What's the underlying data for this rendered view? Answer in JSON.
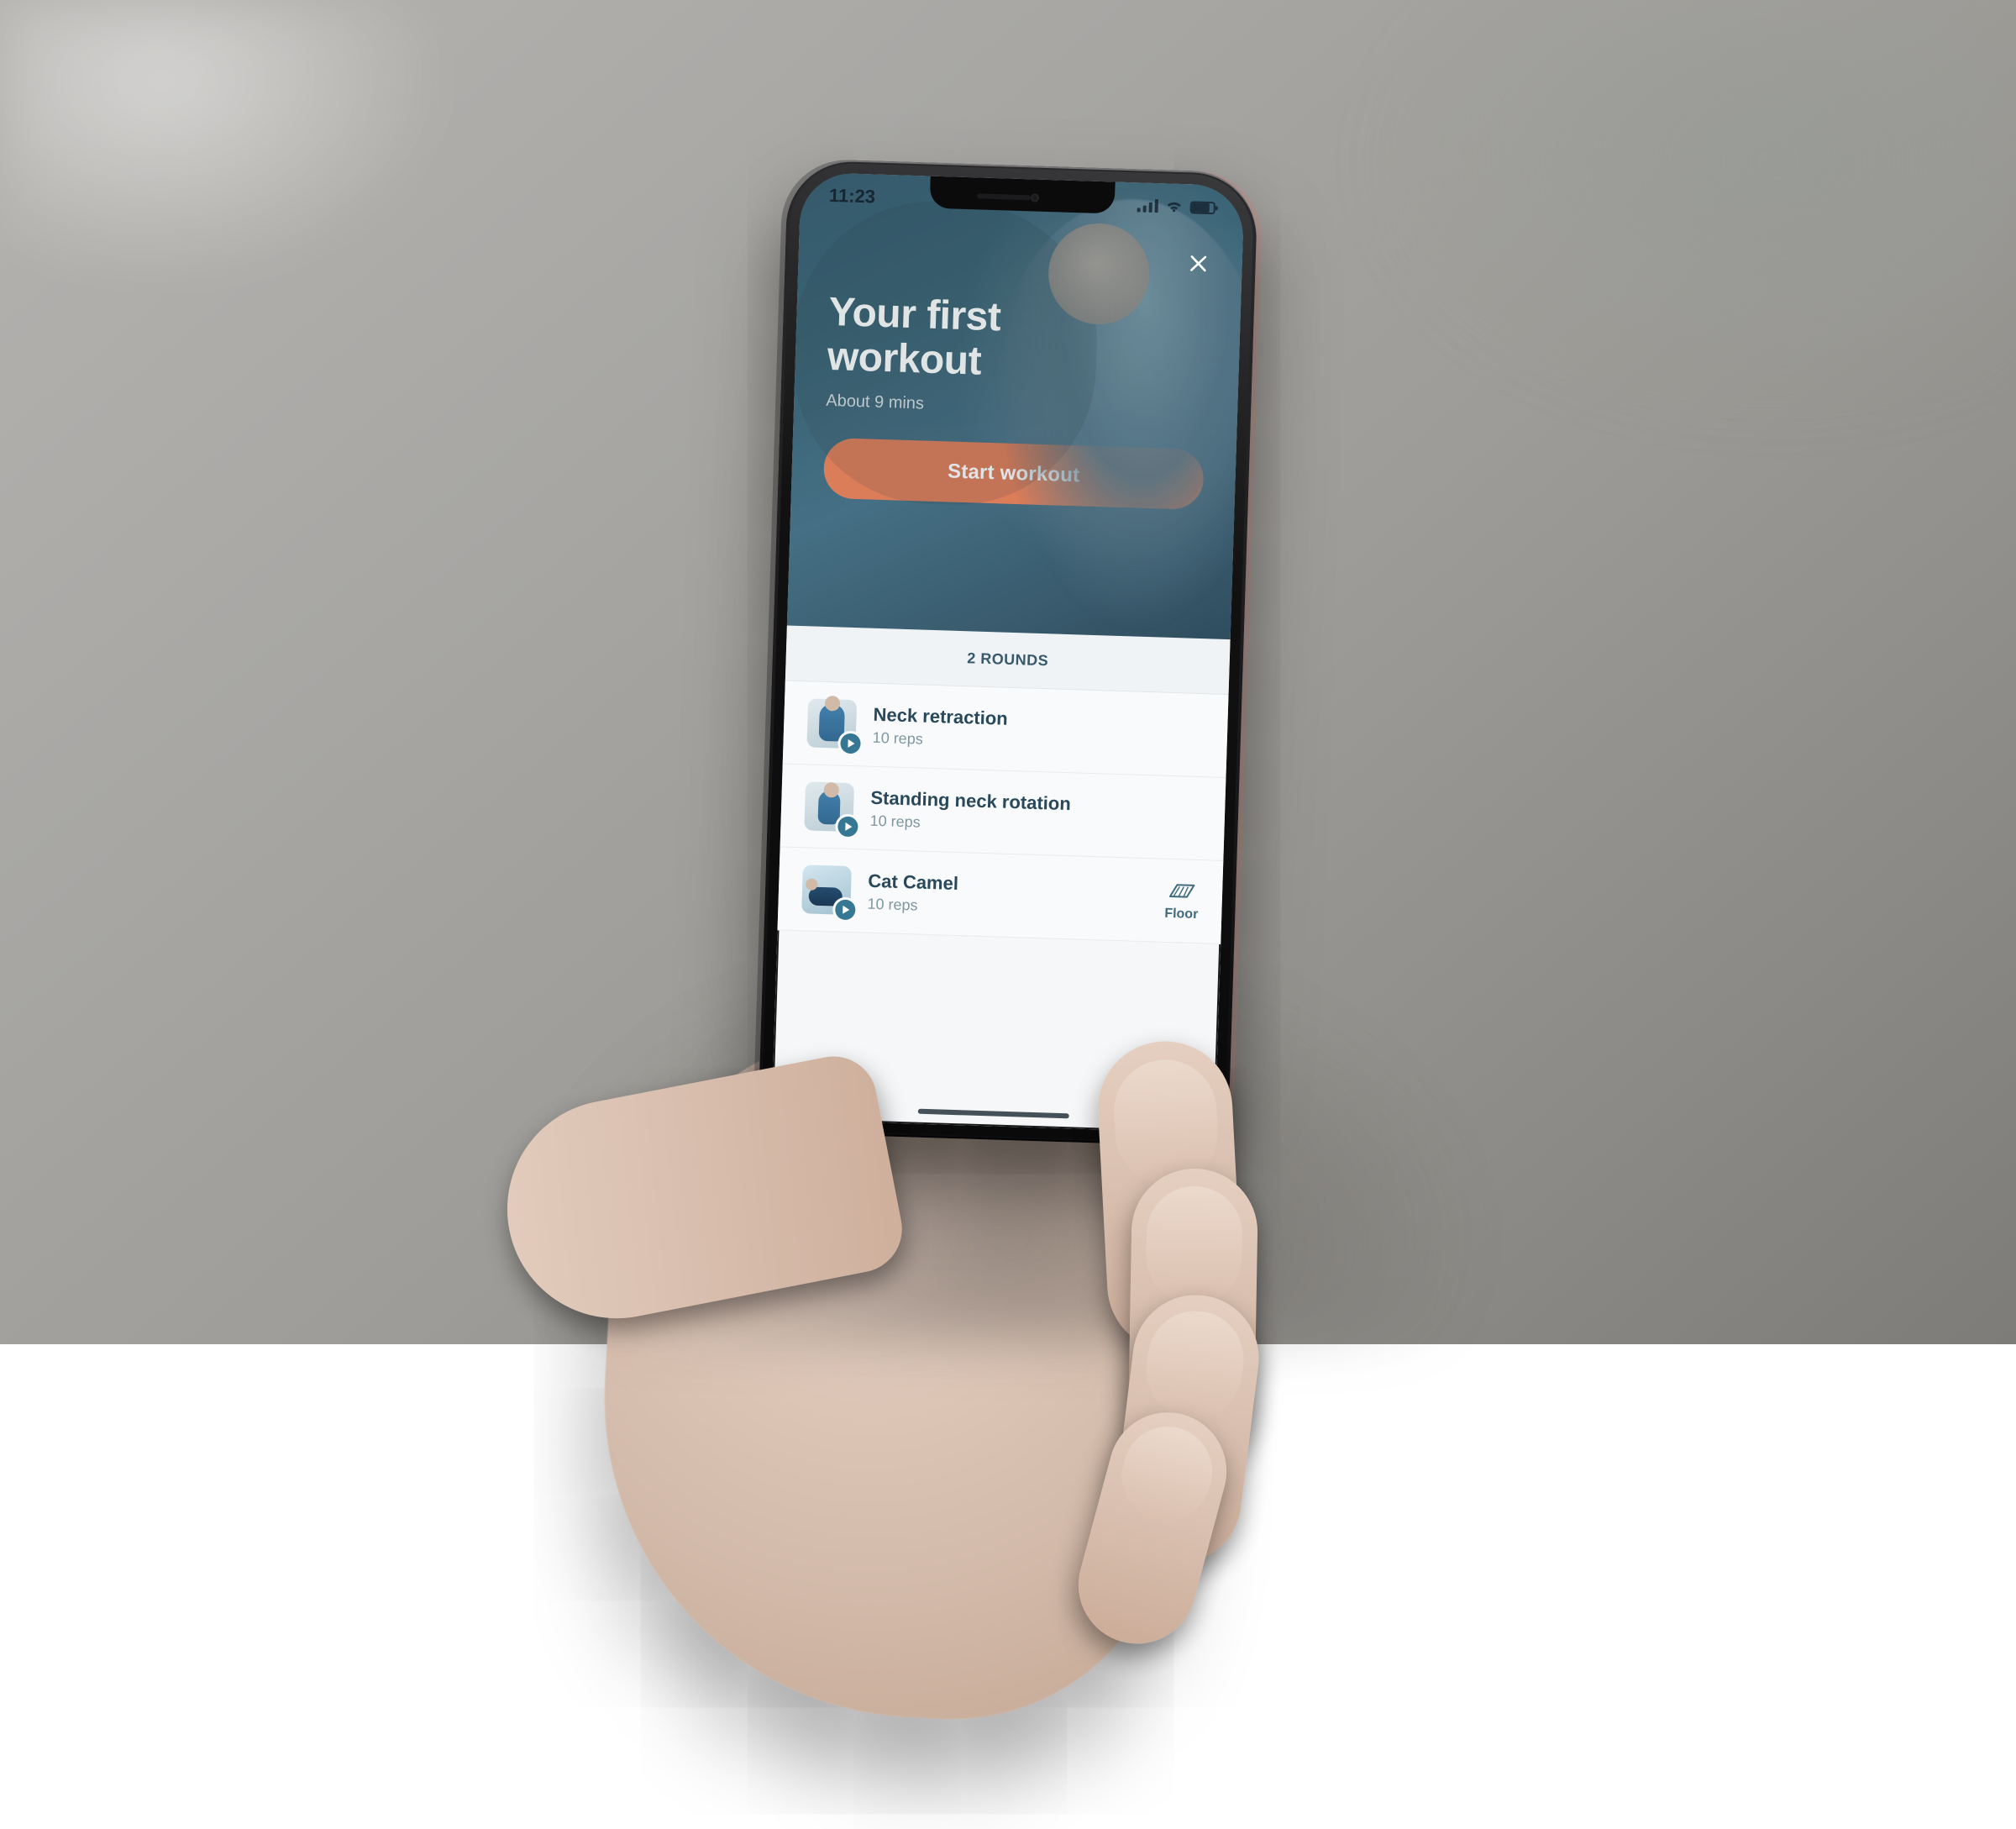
{
  "status": {
    "time": "11:23"
  },
  "hero": {
    "title": "Your first workout",
    "subtitle": "About 9 mins",
    "cta_label": "Start workout"
  },
  "colors": {
    "accent": "#e97a4f"
  },
  "rounds_label": "2 ROUNDS",
  "exercises": [
    {
      "name": "Neck retraction",
      "reps": "10 reps",
      "equipment": null
    },
    {
      "name": "Standing neck rotation",
      "reps": "10 reps",
      "equipment": null
    },
    {
      "name": "Cat Camel",
      "reps": "10 reps",
      "equipment": "Floor"
    }
  ]
}
